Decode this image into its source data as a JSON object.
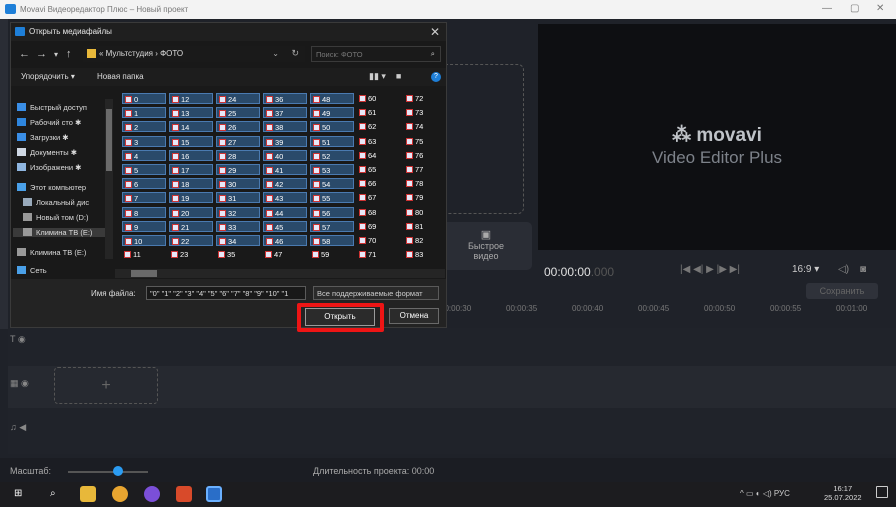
{
  "window": {
    "title": "Movavi Видеоредактор Плюс – Новый проект",
    "min": "—",
    "max": "▢",
    "close": "✕"
  },
  "preview": {
    "brand": "movavi",
    "product": "Video Editor Plus"
  },
  "player": {
    "timecode_main": "00:00:00",
    "timecode_frac": ".000",
    "ratio": "16:9 ▾"
  },
  "save_label": "Сохранить",
  "quick_video": {
    "line1": "Быстрое",
    "line2": "видео"
  },
  "ruler": [
    "00:00:30",
    "00:00:35",
    "00:00:40",
    "00:00:45",
    "00:00:50",
    "00:00:55",
    "00:01:00"
  ],
  "status": {
    "scale_label": "Масштаб:",
    "duration": "Длительность проекта: 00:00"
  },
  "taskbar": {
    "lang": "РУС",
    "time": "16:17",
    "date": "25.07.2022"
  },
  "dialog": {
    "title": "Открыть медиафайлы",
    "path": "« Мультстудия › ФОТО",
    "search_placeholder": "Поиск: ФОТО",
    "organize": "Упорядочить ▾",
    "new_folder": "Новая папка",
    "nav_items": [
      {
        "label": "Быстрый доступ",
        "icon": "star-icon",
        "color": "#3a8ee6"
      },
      {
        "label": "Рабочий сто ✱",
        "icon": "desktop-icon",
        "color": "#2e86de"
      },
      {
        "label": "Загрузки ✱",
        "icon": "download-icon",
        "color": "#3a8ee6"
      },
      {
        "label": "Документы ✱",
        "icon": "document-icon",
        "color": "#cfd8e4"
      },
      {
        "label": "Изображени ✱",
        "icon": "pictures-icon",
        "color": "#8fb6e0"
      },
      {
        "label": "Этот компьютер",
        "icon": "computer-icon",
        "color": "#4aa0e8"
      },
      {
        "label": "Локальный дис",
        "icon": "drive-icon",
        "color": "#9ab"
      },
      {
        "label": "Новый том (D:)",
        "icon": "drive-icon",
        "color": "#999"
      },
      {
        "label": "Климина ТВ (E:)",
        "icon": "drive-icon",
        "color": "#999"
      },
      {
        "label": "Климина ТВ (E:)",
        "icon": "drive-icon",
        "color": "#999"
      },
      {
        "label": "Сеть",
        "icon": "network-icon",
        "color": "#4aa0e8"
      }
    ],
    "file_columns": [
      [
        "0",
        "1",
        "2",
        "3",
        "4",
        "5",
        "6",
        "7",
        "8",
        "9",
        "10",
        "11"
      ],
      [
        "12",
        "13",
        "14",
        "15",
        "16",
        "17",
        "18",
        "19",
        "20",
        "21",
        "22",
        "23"
      ],
      [
        "24",
        "25",
        "26",
        "27",
        "28",
        "29",
        "30",
        "31",
        "32",
        "33",
        "34",
        "35"
      ],
      [
        "36",
        "37",
        "38",
        "39",
        "40",
        "41",
        "42",
        "43",
        "44",
        "45",
        "46",
        "47"
      ],
      [
        "48",
        "49",
        "50",
        "51",
        "52",
        "53",
        "54",
        "55",
        "56",
        "57",
        "58",
        "59"
      ],
      [
        "60",
        "61",
        "62",
        "63",
        "64",
        "65",
        "66",
        "67",
        "68",
        "69",
        "70",
        "71"
      ],
      [
        "72",
        "73",
        "74",
        "75",
        "76",
        "77",
        "78",
        "79",
        "80",
        "81",
        "82",
        "83"
      ]
    ],
    "filename_label": "Имя файла:",
    "filename_value": "\"0\" \"1\" \"2\" \"3\" \"4\" \"5\" \"6\" \"7\" \"8\" \"9\" \"10\" \"1",
    "filetype_value": "Все поддерживаемые формат",
    "open_label": "Открыть",
    "cancel_label": "Отмена"
  }
}
